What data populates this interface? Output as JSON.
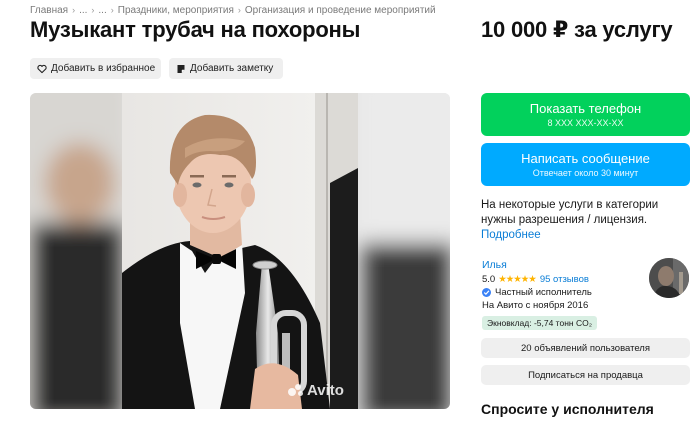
{
  "breadcrumb": {
    "items": [
      "Главная",
      "...",
      "...",
      "Праздники, мероприятия",
      "Организация и проведение мероприятий"
    ]
  },
  "listing": {
    "title": "Музыкант трубач на похороны",
    "price": "10 000 ₽ за услугу"
  },
  "actions": {
    "favorite_label": "Добавить в избранное",
    "note_label": "Добавить заметку"
  },
  "gallery": {
    "watermark": "Avito"
  },
  "contact": {
    "phone_label": "Показать телефон",
    "phone_masked": "8 XXX XXX-XX-XX",
    "message_label": "Написать сообщение",
    "message_sub": "Отвечает около 30 минут"
  },
  "notice": {
    "text": "На некоторые услуги в категории нужны разрешения / лицензия.",
    "link": "Подробнее"
  },
  "seller": {
    "name": "Илья",
    "rating": "5.0",
    "stars": "★★★★★",
    "reviews": "95 отзывов",
    "type": "Частный исполнитель",
    "since": "На Авито с ноября 2016",
    "eco_badge": "Экновклад: -5,74 тонн CO₂",
    "ads_button": "20 объявлений пользователя",
    "subscribe_button": "Подписаться на продавца"
  },
  "ask": {
    "heading": "Спросите у исполнителя"
  },
  "colors": {
    "phone_button": "#02d15c",
    "message_button": "#00aaff",
    "link": "#0a7dd6",
    "star": "#ffb400",
    "eco_badge_bg": "#d9efe3"
  }
}
